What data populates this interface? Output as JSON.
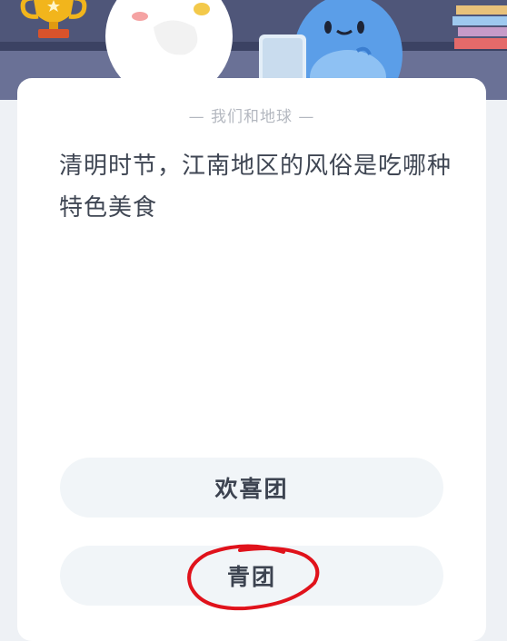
{
  "quiz": {
    "category": "— 我们和地球 —",
    "question": "清明时节，江南地区的风俗是吃哪种特色美食",
    "options": [
      {
        "label": "欢喜团"
      },
      {
        "label": "青团"
      }
    ],
    "highlighted_option_index": 1
  },
  "colors": {
    "banner": "#4f5679",
    "card": "#ffffff",
    "option_bg": "#f1f5f8",
    "annotation": "#e0121b"
  }
}
